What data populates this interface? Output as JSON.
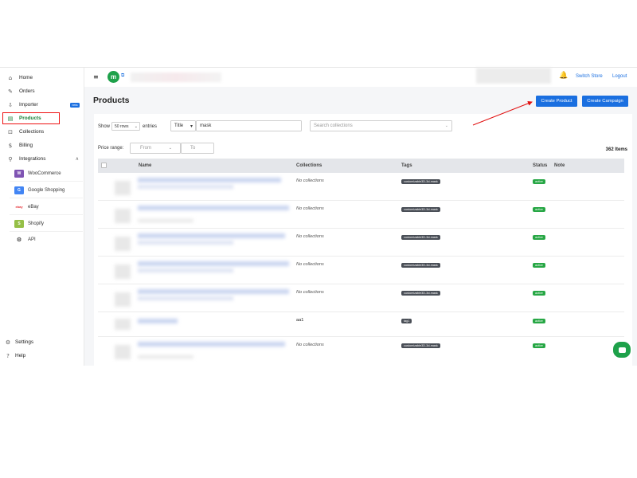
{
  "sidebar": {
    "items": [
      {
        "label": "Home",
        "icon": "home-icon",
        "glyph": "⌂"
      },
      {
        "label": "Orders",
        "icon": "orders-icon",
        "glyph": "✎"
      },
      {
        "label": "Importer",
        "icon": "importer-icon",
        "glyph": "⇩",
        "badge": "beta"
      },
      {
        "label": "Products",
        "icon": "products-icon",
        "glyph": "▤"
      },
      {
        "label": "Collections",
        "icon": "collections-icon",
        "glyph": "⊡"
      },
      {
        "label": "Billing",
        "icon": "billing-icon",
        "glyph": "$"
      },
      {
        "label": "Integrations",
        "icon": "integrations-icon",
        "glyph": "⚲"
      }
    ],
    "integrations": [
      {
        "label": "WooCommerce",
        "glyph": "W",
        "color": "#7f54b3"
      },
      {
        "label": "Google Shopping",
        "glyph": "G",
        "color": "#4285f4"
      },
      {
        "label": "eBay",
        "glyph": "ebay",
        "color": "#e53238"
      },
      {
        "label": "Shopify",
        "glyph": "S",
        "color": "#95bf47"
      },
      {
        "label": "API",
        "glyph": "⚙",
        "color": "#666666"
      }
    ],
    "footer": [
      {
        "label": "Settings",
        "glyph": "⚙"
      },
      {
        "label": "Help",
        "glyph": "?"
      }
    ]
  },
  "topbar": {
    "menu_glyph": "≡",
    "logo_text": "m",
    "ext_glyph": "⧉",
    "bell_glyph": "🔔",
    "switch_store": "Switch Store",
    "logout": "Logout"
  },
  "page": {
    "title": "Products",
    "create_product": "Create Product",
    "create_campaign": "Create Campaign"
  },
  "filters": {
    "show_label": "Show",
    "rows_value": "50 rows",
    "entries_label": "entries",
    "field_value": "Title",
    "search_value": "mask",
    "collections_placeholder": "Search collections",
    "price_label": "Price range:",
    "from_placeholder": "From",
    "to_placeholder": "To",
    "items_count": "362 Items"
  },
  "table": {
    "headers": {
      "name": "Name",
      "collections": "Collections",
      "tags": "Tags",
      "status": "Status",
      "note": "Note"
    },
    "rows": [
      {
        "collections": "No collections",
        "tag": "customizable3D-3d-mask",
        "status": "active"
      },
      {
        "collections": "No collections",
        "tag": "customizable3D-3d-mask",
        "status": "active"
      },
      {
        "collections": "No collections",
        "tag": "customizable3D-3d-mask",
        "status": "active"
      },
      {
        "collections": "No collections",
        "tag": "customizable3D-3d-mask",
        "status": "active"
      },
      {
        "collections": "No collections",
        "tag": "customizable3D-3d-mask",
        "status": "active"
      },
      {
        "collections": "aa1",
        "tag": "tag1",
        "status": "active"
      },
      {
        "collections": "No collections",
        "tag": "customizable3D-3d-mask",
        "status": "active"
      }
    ]
  },
  "colors": {
    "accent": "#1a6fe0",
    "brand_green": "#1ea14a",
    "active_status": "#27a745",
    "highlight_red": "#e11111"
  }
}
